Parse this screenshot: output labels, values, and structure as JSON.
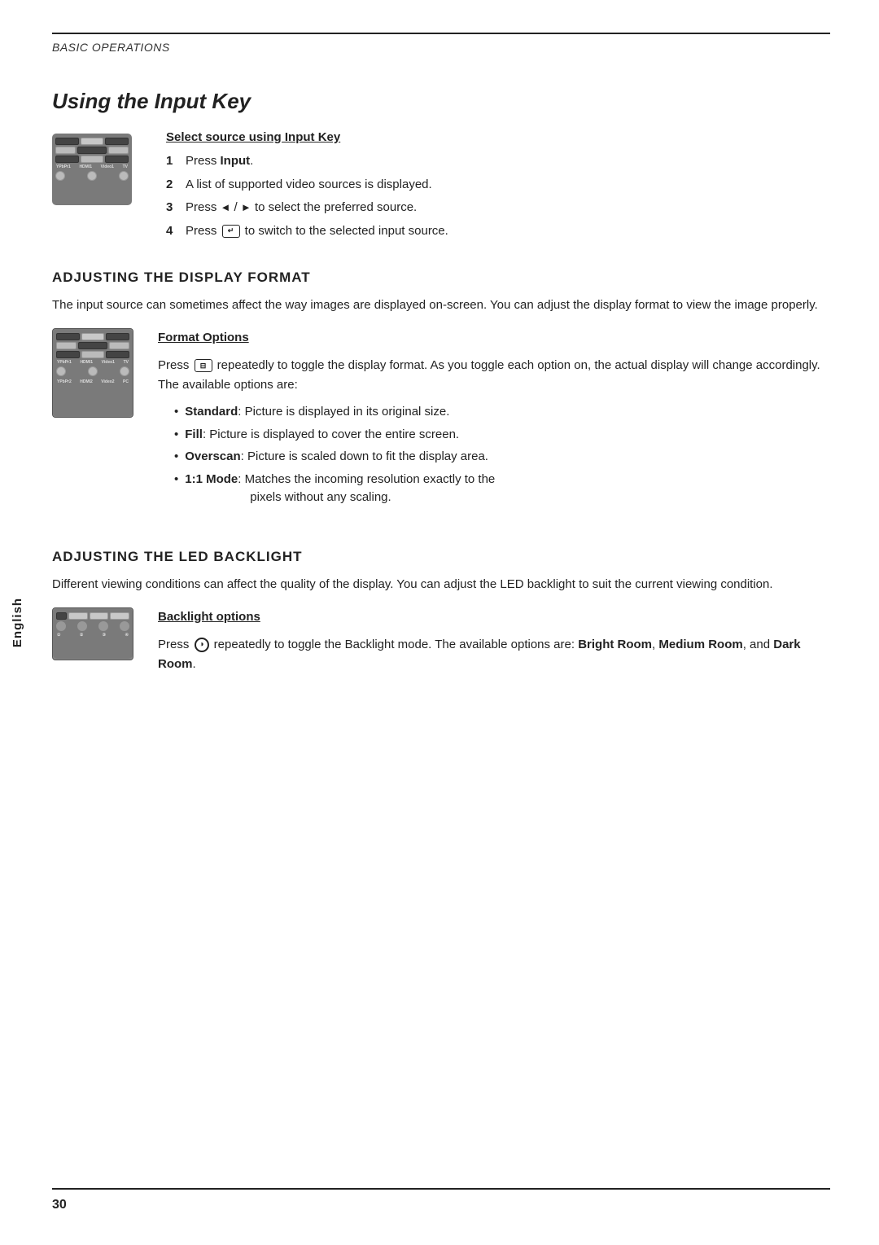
{
  "sidebar": {
    "label": "English"
  },
  "header": {
    "section": "BASIC OPERATIONS",
    "title": "Using the Input Key"
  },
  "input_key_section": {
    "subtitle": "Select source using Input Key",
    "steps": [
      {
        "num": "1",
        "text_plain": "Press ",
        "text_bold": "Input",
        "text_rest": "."
      },
      {
        "num": "2",
        "text_plain": "A list of supported video sources is displayed.",
        "text_bold": "",
        "text_rest": ""
      },
      {
        "num": "3",
        "text_plain": "Press  /  to select the preferred source.",
        "text_bold": "",
        "text_rest": ""
      },
      {
        "num": "4",
        "text_plain": "Press  to switch to the selected input source.",
        "text_bold": "",
        "text_rest": ""
      }
    ]
  },
  "adjusting_display": {
    "title": "ADJUSTING THE DISPLAY FORMAT",
    "intro": "The input source can sometimes affect the way images are displayed on-screen. You can adjust the display format to view the image properly.",
    "subtitle": "Format Options",
    "description": "Press  repeatedly to toggle the display format. As you toggle each option on, the actual display will change accordingly. The available options are:",
    "bullets": [
      {
        "bold": "Standard",
        "rest": ": Picture is displayed in its original size."
      },
      {
        "bold": "Fill",
        "rest": ": Picture is displayed to cover the entire screen."
      },
      {
        "bold": "Overscan",
        "rest": ": Picture is scaled down to fit the display area."
      },
      {
        "bold": "1:1 Mode",
        "rest": ": Matches the incoming resolution exactly to the pixels without any scaling."
      }
    ]
  },
  "adjusting_backlight": {
    "title": "ADJUSTING THE LED BACKLIGHT",
    "intro": "Different viewing conditions can affect the quality of the display. You can adjust the LED backlight to suit the current viewing condition.",
    "subtitle": "Backlight options",
    "description": "Press  repeatedly to toggle the Backlight mode. The available options are: ",
    "options_bold": [
      "Bright Room",
      "Medium Room",
      "Dark Room"
    ],
    "options_rest": [
      ", ",
      ", and ",
      "."
    ]
  },
  "footer": {
    "page_number": "30"
  }
}
